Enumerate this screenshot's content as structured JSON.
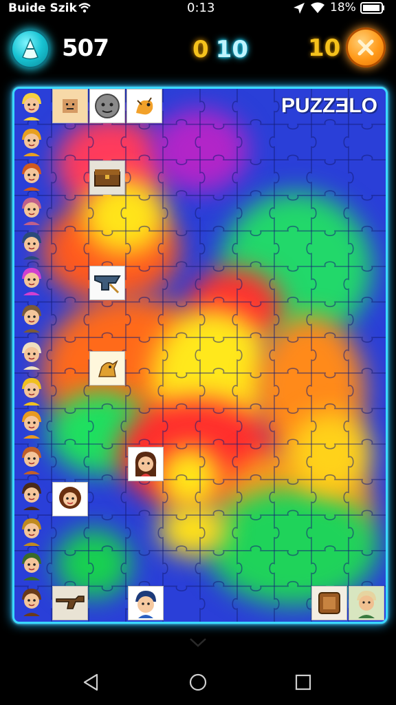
{
  "status_bar": {
    "carrier": "Buide Szik",
    "time": "0:13",
    "battery_percent": "18%"
  },
  "header": {
    "score": "507",
    "pair_left": "0",
    "pair_right": "10",
    "moves": "10",
    "hint_icon": "cone-icon",
    "close_icon": "close-x-icon"
  },
  "board": {
    "title": "PUZZƎLO",
    "accent_color": "#3ad8ff",
    "side_icons": [
      "clown-face",
      "crossed-swords",
      "girl-red-hair",
      "girl-pink",
      "hooded-figure",
      "pink-creature",
      "girl-blue-dress",
      "bald-baby",
      "yellow-hat-kid",
      "blonde-kid",
      "orange-hat-man",
      "dark-hair-kid",
      "robot-tiki",
      "green-shirt-kid",
      "boy-brown"
    ],
    "placed_tiles": [
      "block-man",
      "stone-face",
      "orange-dragon",
      "treasure-chest",
      "anvil-tool",
      "goat-creature",
      "brown-hair-girl",
      "curly-girl",
      "weapon",
      "blue-hair-boy",
      "wooden-crate",
      "old-man"
    ]
  },
  "navigation": {
    "back_icon": "triangle-back-icon",
    "home_icon": "circle-home-icon",
    "recents_icon": "square-recents-icon"
  }
}
